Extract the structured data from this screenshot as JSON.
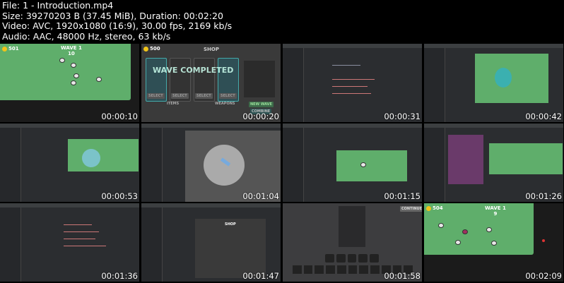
{
  "header": {
    "file": "File: 1 - Introduction.mp4",
    "size": "Size: 39270203 B (37.45 MiB), Duration: 00:02:20",
    "video": "Video: AVC, 1920x1080 (16:9), 30.00 fps, 2169 kb/s",
    "audio": "Audio: AAC, 48000 Hz, stereo, 63 kb/s"
  },
  "thumbs": [
    {
      "time": "00:00:10",
      "coins": "501",
      "wave": "WAVE 1",
      "count": "10"
    },
    {
      "time": "00:00:20",
      "coins": "500",
      "title": "SHOP",
      "banner": "WAVE COMPLETED",
      "select": "SELECT",
      "new_wave": "NEW WAVE",
      "combine": "COMBINE",
      "items": "ITEMS",
      "weapons": "WEAPONS"
    },
    {
      "time": "00:00:31"
    },
    {
      "time": "00:00:42"
    },
    {
      "time": "00:00:53"
    },
    {
      "time": "00:01:04"
    },
    {
      "time": "00:01:15"
    },
    {
      "time": "00:01:26"
    },
    {
      "time": "00:01:36"
    },
    {
      "time": "00:01:47",
      "title": "SHOP"
    },
    {
      "time": "00:01:58",
      "continue": "CONTINUE"
    },
    {
      "time": "00:02:09",
      "coins": "504",
      "wave": "WAVE 1",
      "count": "9"
    }
  ],
  "colors": {
    "field": "#5fae6b",
    "coin": "#f0c419",
    "ide": "#2b2d30"
  }
}
